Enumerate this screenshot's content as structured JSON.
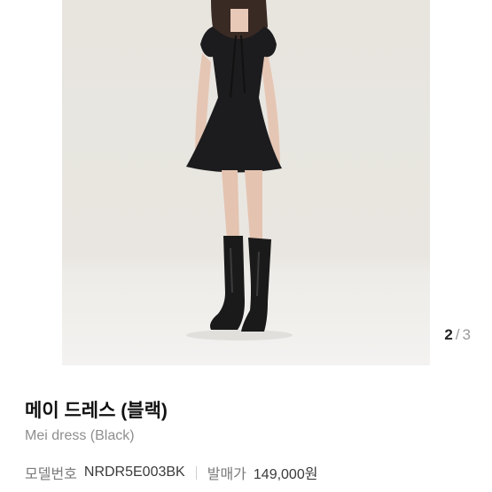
{
  "gallery": {
    "current": "2",
    "separator": "/",
    "total": "3"
  },
  "product": {
    "name_ko": "메이 드레스 (블랙)",
    "name_en": "Mei dress (Black)",
    "model_label": "모델번호",
    "model_value": "NRDR5E003BK",
    "release_price_label": "발매가",
    "release_price_value": "149,000원"
  }
}
